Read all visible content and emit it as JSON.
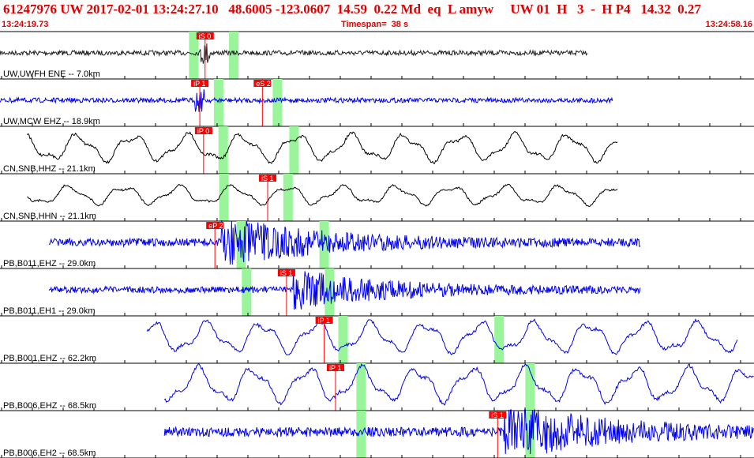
{
  "header": {
    "event_line": "61247976 UW 2017-02-01 13:24:27.10   48.6005 -123.0607  14.59  0.22 Md  eq  L amyw     UW 01  H   3  -  H P4   14.32  0.27",
    "start_time": "13:24:19.73",
    "timespan": "Timespan=  38 s",
    "end_time": "13:24:58.16"
  },
  "colors": {
    "header_text": "#e00000",
    "pick_box": "#ff0000",
    "window_band": "#9af59a",
    "black_trace": "#000000",
    "blue_trace": "#0000ee",
    "dark_trace": "#222222"
  },
  "channels": [
    {
      "label": "UW,UWFH ENE -- 7.0km",
      "color": "dark",
      "start": 0.0,
      "end": 0.78,
      "amp": 3,
      "mode": "noise",
      "bands": [
        0.257,
        0.31
      ],
      "picks": [
        {
          "label": "iS 0",
          "pos": 0.272
        }
      ]
    },
    {
      "label": "UW,MCW EHZ -- 18.9km",
      "color": "blue",
      "start": 0.0,
      "end": 0.813,
      "amp": 3,
      "mode": "noise",
      "bands": [
        0.29,
        0.368
      ],
      "picks": [
        {
          "label": "iP 1",
          "pos": 0.265
        },
        {
          "label": "eS 2",
          "pos": 0.348
        }
      ]
    },
    {
      "label": "CN,SNB,HHZ -- 21.1km",
      "color": "black",
      "start": 0.036,
      "end": 0.82,
      "amp": 14,
      "mode": "wave",
      "bands": [
        0.296,
        0.39
      ],
      "picks": [
        {
          "label": "iP 0",
          "pos": 0.27
        }
      ]
    },
    {
      "label": "CN,SNB,HHN -- 21.1km",
      "color": "black",
      "start": 0.036,
      "end": 0.82,
      "amp": 10,
      "mode": "wave",
      "bands": [
        0.297,
        0.382
      ],
      "picks": [
        {
          "label": "iS 1",
          "pos": 0.355
        }
      ]
    },
    {
      "label": "PB,B011,EHZ -- 29.0km",
      "color": "blue",
      "start": 0.065,
      "end": 0.85,
      "amp": 5,
      "mode": "quake",
      "bands": [
        0.32,
        0.43
      ],
      "picks": [
        {
          "label": "eP 2",
          "pos": 0.285
        }
      ]
    },
    {
      "label": "PB,B011,EH1 -- 29.0km",
      "color": "blue",
      "start": 0.065,
      "end": 0.85,
      "amp": 4,
      "mode": "quake",
      "bands": [
        0.327,
        0.437
      ],
      "picks": [
        {
          "label": "iS 1",
          "pos": 0.38
        }
      ]
    },
    {
      "label": "PB,B001,EHZ -- 62.2km",
      "color": "blue",
      "start": 0.195,
      "end": 0.978,
      "amp": 16,
      "mode": "wave",
      "bands": [
        0.455,
        0.662
      ],
      "picks": [
        {
          "label": "iP 1",
          "pos": 0.43
        }
      ]
    },
    {
      "label": "PB,B006,EHZ -- 68.5km",
      "color": "blue",
      "start": 0.218,
      "end": 1.0,
      "amp": 18,
      "mode": "wave",
      "bands": [
        0.479,
        0.703
      ],
      "picks": [
        {
          "label": "iP 1",
          "pos": 0.445
        }
      ]
    },
    {
      "label": "PB,B006,EH2 -- 68.5km",
      "color": "blue",
      "start": 0.218,
      "end": 1.0,
      "amp": 6,
      "mode": "quake",
      "bands": [
        0.479,
        0.703
      ],
      "picks": [
        {
          "label": "iS 1",
          "pos": 0.66
        }
      ]
    }
  ]
}
